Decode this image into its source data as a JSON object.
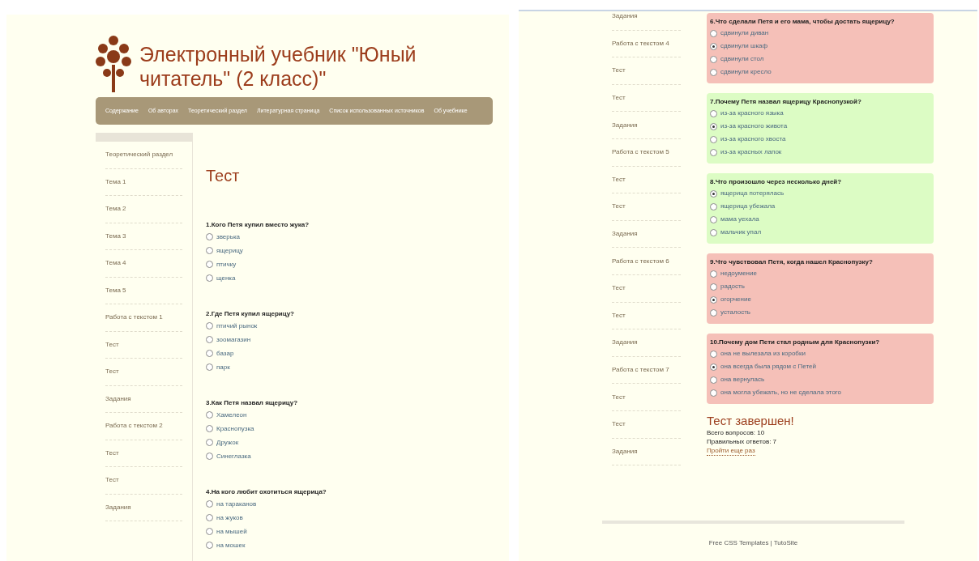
{
  "left_page": {
    "header": {
      "title": "Электронный учебник \"Юный читатель\" (2 класс)\"",
      "nav": [
        "Содержание",
        "Об авторах",
        "Теоретический раздел",
        "Литературная страница",
        "Список использованных источников",
        "Об учебнике"
      ]
    },
    "sidebar": [
      "Теоретический раздел",
      "Тема 1",
      "Тема 2",
      "Тема 3",
      "Тема 4",
      "Тема 5",
      "Работа с текстом 1",
      "Тест",
      "Тест",
      "Задания",
      "Работа с текстом 2",
      "Тест",
      "Тест",
      "Задания"
    ],
    "heading": "Тест",
    "questions": [
      {
        "title": "1.Кого Петя купил вместо жука?",
        "options": [
          {
            "label": "зверька",
            "selected": false
          },
          {
            "label": "ящерицу",
            "selected": false
          },
          {
            "label": "птичку",
            "selected": false
          },
          {
            "label": "щенка",
            "selected": false
          }
        ]
      },
      {
        "title": "2.Где Петя купил ящерицу?",
        "options": [
          {
            "label": "птичий рынок",
            "selected": false
          },
          {
            "label": "зоомагазин",
            "selected": false
          },
          {
            "label": "базар",
            "selected": false
          },
          {
            "label": "парк",
            "selected": false
          }
        ]
      },
      {
        "title": "3.Как Петя назвал ящерицу?",
        "options": [
          {
            "label": "Хамелеон",
            "selected": false
          },
          {
            "label": "Краснопузка",
            "selected": false
          },
          {
            "label": "Дружок",
            "selected": false
          },
          {
            "label": "Синеглазка",
            "selected": false
          }
        ]
      },
      {
        "title": "4.На кого любит охотиться ящерица?",
        "options": [
          {
            "label": "на тараканов",
            "selected": false
          },
          {
            "label": "на жуков",
            "selected": false
          },
          {
            "label": "на мышей",
            "selected": false
          },
          {
            "label": "на мошек",
            "selected": false
          }
        ]
      }
    ]
  },
  "right_page": {
    "sidebar": [
      "Задания",
      "Работа с текстом 4",
      "Тест",
      "Тест",
      "Задания",
      "Работа с текстом 5",
      "Тест",
      "Тест",
      "Задания",
      "Работа с текстом 6",
      "Тест",
      "Тест",
      "Задания",
      "Работа с текстом 7",
      "Тест",
      "Тест",
      "Задания"
    ],
    "questions": [
      {
        "title": "6.Что сделали Петя и его мама, чтобы достать ящерицу?",
        "correct": false,
        "options": [
          {
            "label": "сдвинули диван",
            "selected": false
          },
          {
            "label": "сдвинули шкаф",
            "selected": true
          },
          {
            "label": "сдвинули стол",
            "selected": false
          },
          {
            "label": "сдвинули кресло",
            "selected": false
          }
        ]
      },
      {
        "title": "7.Почему Петя назвал ящерицу Краснопузкой?",
        "correct": true,
        "options": [
          {
            "label": "из-за красного языка",
            "selected": false
          },
          {
            "label": "из-за красного живота",
            "selected": true
          },
          {
            "label": "из-за красного хвоста",
            "selected": false
          },
          {
            "label": "из-за красных лапок",
            "selected": false
          }
        ]
      },
      {
        "title": "8.Что произошло через несколько дней?",
        "correct": true,
        "options": [
          {
            "label": "ящерица потерялась",
            "selected": true
          },
          {
            "label": "ящерица убежала",
            "selected": false
          },
          {
            "label": "мама уехала",
            "selected": false
          },
          {
            "label": "мальчик упал",
            "selected": false
          }
        ]
      },
      {
        "title": "9.Что чувствовал Петя, когда нашел Краснопузку?",
        "correct": false,
        "options": [
          {
            "label": "недоумение",
            "selected": false
          },
          {
            "label": "радость",
            "selected": false
          },
          {
            "label": "огорчение",
            "selected": true
          },
          {
            "label": "усталость",
            "selected": false
          }
        ]
      },
      {
        "title": "10.Почему дом Пети стал родным для Краснопузки?",
        "correct": false,
        "options": [
          {
            "label": "она не вылезала из коробки",
            "selected": false
          },
          {
            "label": "она всегда была рядом с Петей",
            "selected": true
          },
          {
            "label": "она вернулась",
            "selected": false
          },
          {
            "label": "она могла убежать, но не сделала этого",
            "selected": false
          }
        ]
      }
    ],
    "summary": {
      "heading": "Тест завершен!",
      "lines": [
        "Всего вопросов: 10",
        "Правильных ответов: 7"
      ],
      "link": "Пройти еще раз"
    },
    "footer": "Free CSS Templates | TutoSite"
  }
}
